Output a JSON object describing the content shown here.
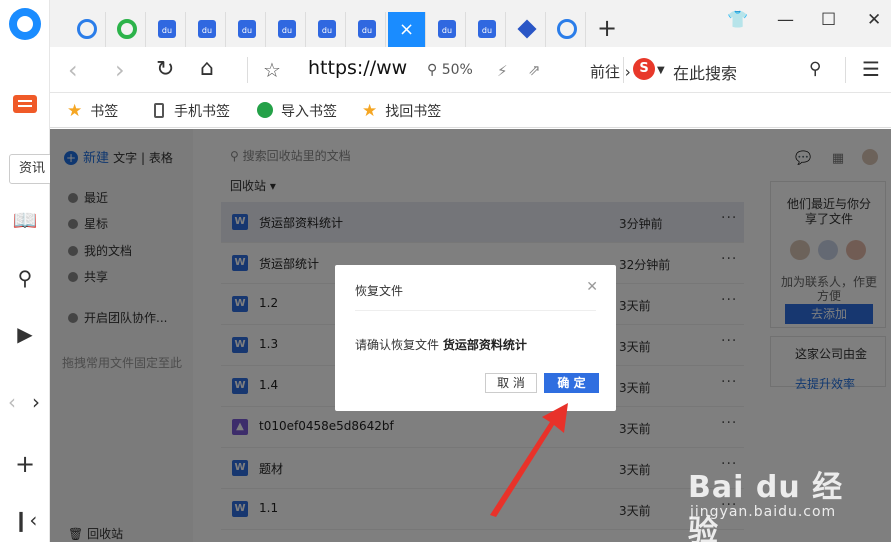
{
  "sidebar": {
    "tooltip": "资讯"
  },
  "tabs": {
    "baidu_label": "du",
    "active_close": "×",
    "new_tab": "+"
  },
  "addressbar": {
    "url": "https://ww",
    "zoom": "50%",
    "goto": "前往",
    "search_placeholder": "在此搜索"
  },
  "bookmarks": {
    "items": [
      "书签",
      "手机书签",
      "导入书签",
      "找回书签"
    ]
  },
  "app": {
    "new_label": "新建",
    "doc_types": "文字 | 表格",
    "nav": [
      "最近",
      "星标",
      "我的文档",
      "共享"
    ],
    "team": "开启团队协作...",
    "pin_hint": "拖拽常用文件固定至此",
    "recycle": "回收站",
    "search_placeholder": "搜索回收站里的文档",
    "breadcrumb": "回收站 ▾",
    "files": [
      {
        "name": "货运部资料统计",
        "time": "3分钟前",
        "type": "W"
      },
      {
        "name": "货运部统计",
        "time": "32分钟前",
        "type": "W"
      },
      {
        "name": "1.2",
        "time": "3天前",
        "type": "W"
      },
      {
        "name": "1.3",
        "time": "3天前",
        "type": "W"
      },
      {
        "name": "1.4",
        "time": "3天前",
        "type": "W"
      },
      {
        "name": "t010ef0458e5d8642bf",
        "time": "3天前",
        "type": "img"
      },
      {
        "name": "题材",
        "time": "3天前",
        "type": "W"
      },
      {
        "name": "1.1",
        "time": "3天前",
        "type": "W"
      }
    ],
    "right_card": {
      "title": "他们最近与你分享了文件",
      "subtitle": "加为联系人，作更方便",
      "button": "去添加"
    },
    "right_card2": {
      "title": "这家公司由金",
      "link": "去提升效率"
    }
  },
  "dialog": {
    "title": "恢复文件",
    "message_prefix": "请确认恢复文件 ",
    "message_file": "货运部资料统计",
    "cancel": "取 消",
    "ok": "确 定"
  },
  "watermark": {
    "brand": "Bai du 经验",
    "url": "jingyan.baidu.com"
  },
  "colors": {
    "accent": "#1a8cff",
    "primary_button": "#2f6ee0",
    "arrow": "#e8322a"
  }
}
